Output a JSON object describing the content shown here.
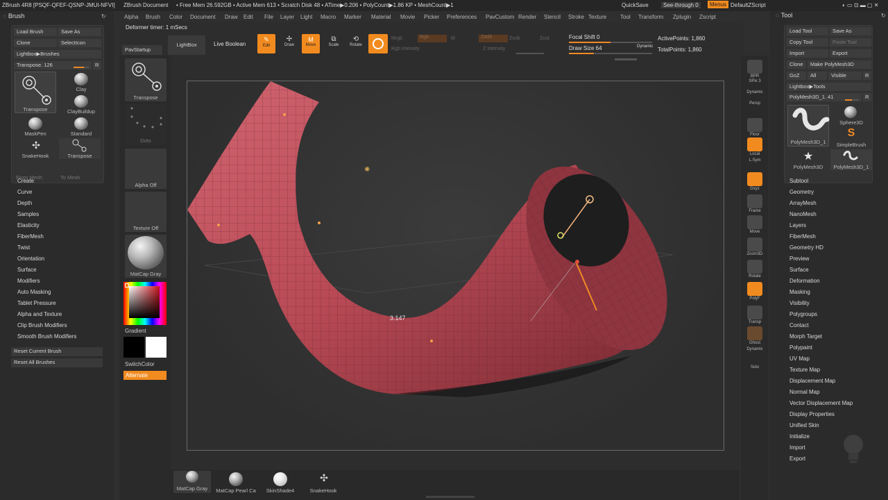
{
  "titlebar": {
    "app": "ZBrush 4R8 [PSQF-QFEF-QSNP-JMUI-NFVI]",
    "document": "ZBrush Document",
    "stats": "• Free Mem 26.592GB • Active Mem 613 • Scratch Disk 48 • ATime▶0.206 • PolyCount▶1.86 KP • MeshCount▶1",
    "quicksave": "QuickSave",
    "see_through": "See-through",
    "see_through_value": "0",
    "menus": "Menus",
    "default_script": "DefaultZScript"
  },
  "menu": [
    "Alpha",
    "Brush",
    "Color",
    "Document",
    "Draw",
    "Edit",
    "File",
    "Layer",
    "Light",
    "Macro",
    "Marker",
    "Material",
    "Movie",
    "Picker",
    "Preferences",
    "PavCustom",
    "Render",
    "Stencil",
    "Stroke",
    "Texture",
    "Tool",
    "Transform",
    "Zplugin",
    "Zscript"
  ],
  "left": {
    "title": "Brush",
    "load_brush": "Load Brush",
    "save_as": "Save As",
    "clone": "Clone",
    "select_icon": "SelectIcon",
    "lightbox_brushes": "Lightbox▶Brushes",
    "transpose_label": "Transpose. 126",
    "transpose_value": 0.7,
    "r_btn": "R",
    "brushes": [
      "Transpose",
      "Clay",
      "ClayBuildup",
      "MaskPen",
      "Standard",
      "SnakeHook",
      "Transpose"
    ],
    "from_mesh": "From Mesh",
    "to_mesh": "To Mesh",
    "menu": [
      "Create",
      "Curve",
      "Depth",
      "Samples",
      "Elasticity",
      "FiberMesh",
      "Twist",
      "Orientation",
      "Surface",
      "Modifiers",
      "Auto Masking",
      "Tablet Pressure",
      "Alpha and Texture",
      "Clip Brush Modifiers",
      "Smooth Brush Modifiers"
    ],
    "reset_current": "Reset Current Brush",
    "reset_all": "Reset All Brushes"
  },
  "toolcol": {
    "pavstartup": "PavStartup",
    "lightbox": "LightBox",
    "transpose": "Transpose",
    "dots": "Dots",
    "alpha_off": "Alpha Off",
    "texture_off": "Texture Off",
    "matcap": "MatCap Gray",
    "gradient": "Gradient",
    "switchcolor": "SwitchColor",
    "alternate": "Alternate"
  },
  "toolbar": {
    "deformer_timer": "Deformer timer: 1 mSecs",
    "live_boolean": "Live Boolean",
    "edit": "Edit",
    "draw": "Draw",
    "move": "Move",
    "scale": "Scale",
    "rotate": "Rotate",
    "mrgb": "Mrgb",
    "rgb": "Rgb",
    "m": "M",
    "rgb_intensity": "Rgb Intensity",
    "zadd": "Zadd",
    "zsub": "Zsub",
    "zcut": "Zcut",
    "z_intensity": "Z Intensity",
    "focal_shift": "Focal Shift 0",
    "draw_size": "Draw Size 64",
    "dynamic": "Dynamic",
    "active_points": "ActivePoints: 1,860",
    "total_points": "TotalPoints: 1,860"
  },
  "viewport": {
    "measurement": "3.147"
  },
  "righticons": [
    "BPR",
    "SPix 3",
    "Dynamic",
    "Persp",
    "Floor",
    "Local",
    "L.Sym",
    "Gxyz",
    "Frame",
    "Move",
    "Zoom3D",
    "Rotate",
    "PolyF",
    "Transp",
    "Ghost",
    "Dynamic",
    "Solo"
  ],
  "right": {
    "title": "Tool",
    "load_tool": "Load Tool",
    "save_as": "Save As",
    "copy_tool": "Copy Tool",
    "paste_tool": "Paste Tool",
    "import": "Import",
    "export": "Export",
    "clone": "Clone",
    "make_polymesh": "Make PolyMesh3D",
    "goz": "GoZ",
    "all": "All",
    "visible": "Visible",
    "r": "R",
    "lightbox_tools": "Lightbox▶Tools",
    "current_tool": "PolyMesh3D_1. 41",
    "tools": [
      "PolyMesh3D_1",
      "Sphere3D",
      "SimpleBrush",
      "PolyMesh3D",
      "PolyMesh3D_1"
    ],
    "menu": [
      "Subtool",
      "Geometry",
      "ArrayMesh",
      "NanoMesh",
      "Layers",
      "FiberMesh",
      "Geometry HD",
      "Preview",
      "Surface",
      "Deformation",
      "Masking",
      "Visibility",
      "Polygroups",
      "Contact",
      "Morph Target",
      "Polypaint",
      "UV Map",
      "Texture Map",
      "Displacement Map",
      "Normal Map",
      "Vector Displacement Map",
      "Display Properties",
      "Unified Skin",
      "Initialize",
      "Import",
      "Export"
    ]
  },
  "bottom": {
    "materials": [
      "MatCap Gray",
      "MatCap Pearl Ca",
      "SkinShade4",
      "SnakeHook"
    ]
  },
  "colors": {
    "accent": "#f28b1f",
    "model": "#b84a55"
  }
}
